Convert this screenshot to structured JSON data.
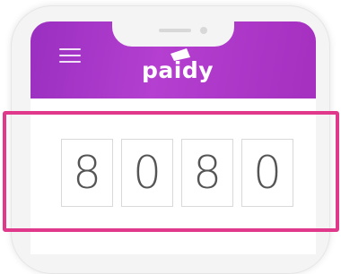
{
  "header": {
    "logo_text": "paidy",
    "menu_icon": "hamburger-menu-icon"
  },
  "code": {
    "digits": [
      "8",
      "0",
      "8",
      "0"
    ]
  },
  "colors": {
    "header_gradient_start": "#9a2fc0",
    "header_gradient_end": "#b43fd0",
    "highlight_border": "#e0388a"
  }
}
